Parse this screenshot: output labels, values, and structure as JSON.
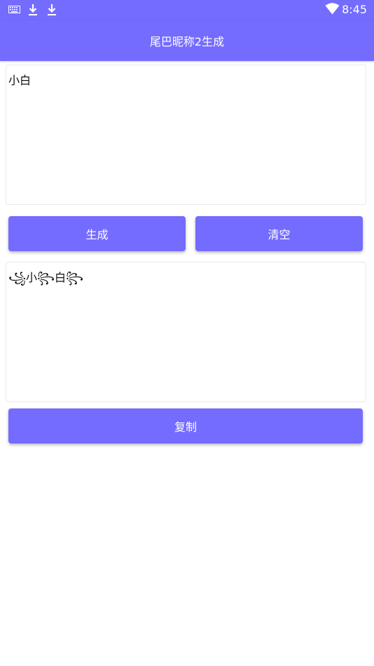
{
  "statusbar": {
    "time": "8:45",
    "icons": [
      "keyboard-icon",
      "download-icon",
      "download-icon",
      "wifi-icon"
    ]
  },
  "appbar": {
    "title": "尾巴昵称2生成"
  },
  "input": {
    "value": "小白"
  },
  "buttons": {
    "generate_label": "生成",
    "clear_label": "清空",
    "copy_label": "复制"
  },
  "output": {
    "value": "꧁小꧂白꧂"
  },
  "colors": {
    "primary": "#746cff",
    "background": "#ffffff",
    "border": "#eaeaea"
  }
}
